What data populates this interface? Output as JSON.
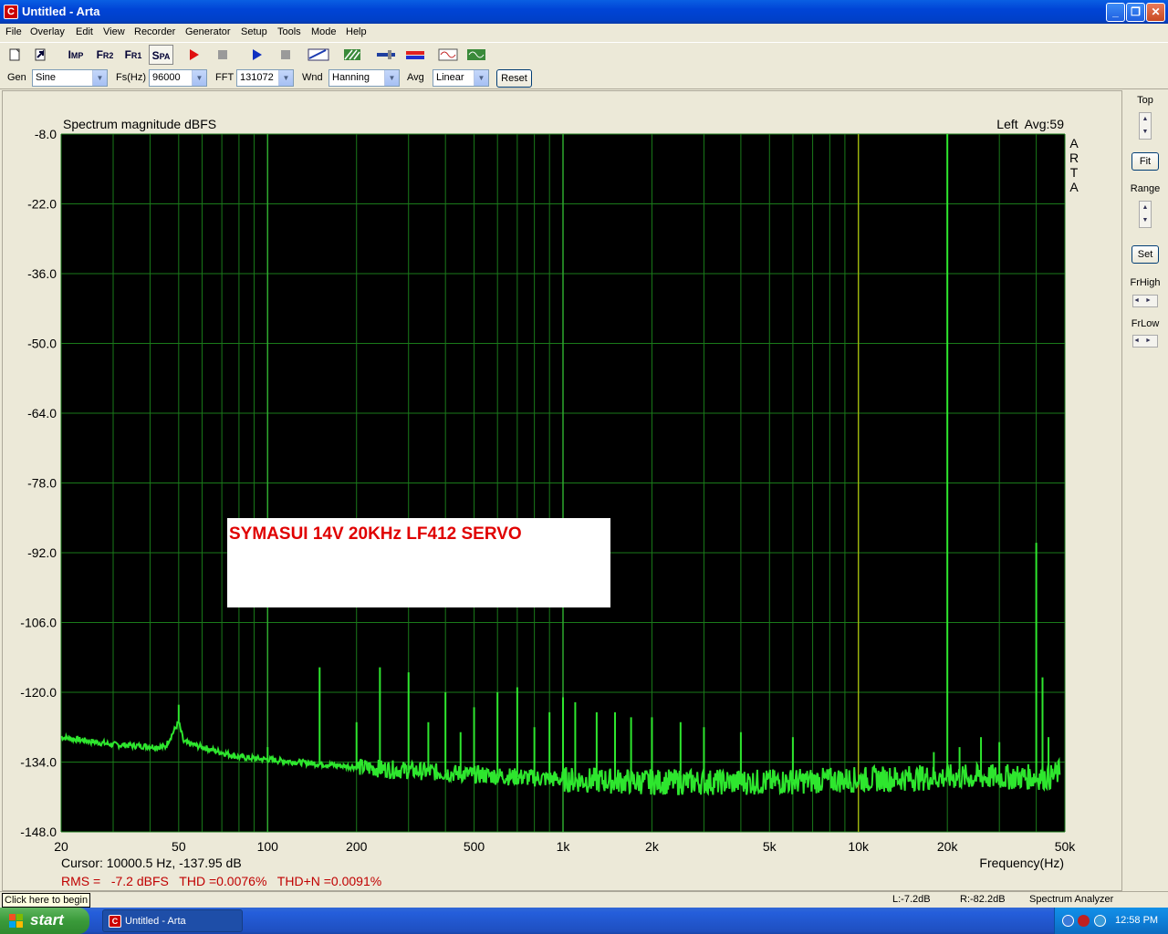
{
  "window": {
    "title": "Untitled - Arta",
    "app_icon": "C",
    "buttons": [
      "_",
      "❐",
      "✕"
    ]
  },
  "menu": [
    "File",
    "Overlay",
    "Edit",
    "View",
    "Recorder",
    "Generator",
    "Setup",
    "Tools",
    "Mode",
    "Help"
  ],
  "toolbar": {
    "imp": {
      "main": "I",
      "sub": "MP"
    },
    "fr2": {
      "main": "F",
      "sub": "R2"
    },
    "fr1": {
      "main": "F",
      "sub": "R1"
    },
    "spa": {
      "main": "S",
      "sub": "PA"
    }
  },
  "genbar": {
    "gen_label": "Gen",
    "gen_value": "Sine",
    "fs_label": "Fs(Hz)",
    "fs_value": "96000",
    "fft_label": "FFT",
    "fft_value": "131072",
    "wnd_label": "Wnd",
    "wnd_value": "Hanning",
    "avg_label": "Avg",
    "avg_value": "Linear",
    "reset_label": "Reset"
  },
  "plot": {
    "title": "Spectrum magnitude dBFS",
    "channel_info": "Left  Avg:59",
    "arta_label": [
      "A",
      "R",
      "T",
      "A"
    ],
    "x_axis_label": "Frequency(Hz)",
    "cursor_text": "Cursor: 10000.5 Hz, -137.95 dB",
    "measure_text": "RMS =   -7.2 dBFS   THD =0.0076%   THD+N =0.0091%",
    "annotation": "SYMASUI 14V 20KHz LF412 SERVO",
    "colors": {
      "background": "#000000",
      "grid": "#1a7a1a",
      "trace": "#2ee62e",
      "cursor": "#c8b400",
      "annotation": "#e00000",
      "measure": "#c00000"
    }
  },
  "chart_data": {
    "type": "line",
    "title": "Spectrum magnitude dBFS",
    "xlabel": "Frequency(Hz)",
    "ylabel": "",
    "x_scale": "log",
    "xlim": [
      20,
      50000
    ],
    "ylim": [
      -148,
      -8
    ],
    "y_ticks": [
      "-8.0",
      "-22.0",
      "-36.0",
      "-50.0",
      "-64.0",
      "-78.0",
      "-92.0",
      "-106.0",
      "-120.0",
      "-134.0",
      "-148.0"
    ],
    "x_ticks": [
      "20",
      "50",
      "100",
      "200",
      "500",
      "1k",
      "2k",
      "5k",
      "10k",
      "20k",
      "50k"
    ],
    "grid": true,
    "cursor_hz": 10000.5,
    "noise_floor": [
      [
        20,
        -129
      ],
      [
        30,
        -130.5
      ],
      [
        45,
        -131
      ],
      [
        50,
        -126
      ],
      [
        52,
        -130
      ],
      [
        80,
        -133
      ],
      [
        100,
        -133.5
      ],
      [
        200,
        -135
      ],
      [
        500,
        -136.5
      ],
      [
        1000,
        -137.5
      ],
      [
        2000,
        -138
      ],
      [
        5000,
        -138
      ],
      [
        10000,
        -137.5
      ],
      [
        20000,
        -137
      ],
      [
        30000,
        -137
      ],
      [
        45000,
        -137
      ],
      [
        48000,
        -136
      ]
    ],
    "peaks": [
      {
        "hz": 50,
        "db": -122.5
      },
      {
        "hz": 100,
        "db": -131
      },
      {
        "hz": 150,
        "db": -115
      },
      {
        "hz": 200,
        "db": -126
      },
      {
        "hz": 240,
        "db": -115
      },
      {
        "hz": 300,
        "db": -116
      },
      {
        "hz": 350,
        "db": -126
      },
      {
        "hz": 400,
        "db": -120
      },
      {
        "hz": 450,
        "db": -128
      },
      {
        "hz": 500,
        "db": -123
      },
      {
        "hz": 600,
        "db": -120
      },
      {
        "hz": 700,
        "db": -119
      },
      {
        "hz": 800,
        "db": -127
      },
      {
        "hz": 900,
        "db": -124
      },
      {
        "hz": 1000,
        "db": -121
      },
      {
        "hz": 1100,
        "db": -122
      },
      {
        "hz": 1300,
        "db": -124
      },
      {
        "hz": 1500,
        "db": -124
      },
      {
        "hz": 1700,
        "db": -125
      },
      {
        "hz": 2000,
        "db": -125
      },
      {
        "hz": 2500,
        "db": -126
      },
      {
        "hz": 3000,
        "db": -127
      },
      {
        "hz": 4000,
        "db": -128
      },
      {
        "hz": 6000,
        "db": -129
      },
      {
        "hz": 18000,
        "db": -132
      },
      {
        "hz": 20000,
        "db": -8
      },
      {
        "hz": 22000,
        "db": -131
      },
      {
        "hz": 26000,
        "db": -129
      },
      {
        "hz": 30000,
        "db": -130
      },
      {
        "hz": 40000,
        "db": -90
      },
      {
        "hz": 42000,
        "db": -117
      },
      {
        "hz": 44000,
        "db": -129
      }
    ]
  },
  "rightpanel": {
    "top": "Top",
    "fit": "Fit",
    "range": "Range",
    "set": "Set",
    "frhigh": "FrHigh",
    "frlow": "FrLow"
  },
  "status": {
    "hint": "Click here to begin",
    "l": "L:-7.2dB",
    "r": "R:-82.2dB",
    "mode": "Spectrum Analyzer"
  },
  "taskbar": {
    "start": "start",
    "task": "Untitled - Arta",
    "clock": "12:58 PM"
  }
}
